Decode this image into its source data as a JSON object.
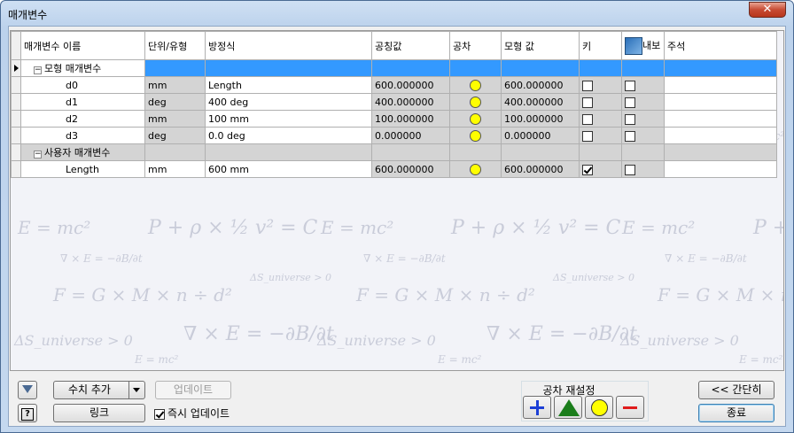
{
  "window": {
    "title": "매개변수",
    "close_glyph": "✕"
  },
  "table": {
    "headers": [
      "매개변수 이름",
      "단위/유형",
      "방정식",
      "공칭값",
      "공차",
      "모형 값",
      "키",
      "내보",
      "주석"
    ],
    "groups": [
      {
        "label": "모형 매개변수",
        "expander": "−",
        "rows": [
          {
            "name": "d0",
            "unit": "mm",
            "equation": "Length",
            "nominal": "600.000000",
            "model": "600.000000",
            "key": false,
            "export": false
          },
          {
            "name": "d1",
            "unit": "deg",
            "equation": "400 deg",
            "nominal": "400.000000",
            "model": "400.000000",
            "key": false,
            "export": false
          },
          {
            "name": "d2",
            "unit": "mm",
            "equation": "100 mm",
            "nominal": "100.000000",
            "model": "100.000000",
            "key": false,
            "export": false
          },
          {
            "name": "d3",
            "unit": "deg",
            "equation": "0.0 deg",
            "nominal": "0.000000",
            "model": "0.000000",
            "key": false,
            "export": false
          }
        ]
      },
      {
        "label": "사용자 매개변수",
        "expander": "−",
        "rows": [
          {
            "name": "Length",
            "unit": "mm",
            "equation": "600 mm",
            "nominal": "600.000000",
            "model": "600.000000",
            "key": true,
            "export": false
          }
        ]
      }
    ],
    "tolerance_color": "#ffff00",
    "selection_color": "#3399ff"
  },
  "background_formulas": {
    "emc2": "E = mc²",
    "bernoulli": "P + ρ × ½ v² = C",
    "curl": "∇ × E = −∂B/∂t",
    "gravity": "F = G × M × n ÷ d²",
    "entropy": "ΔS_universe > 0"
  },
  "toolbar": {
    "filter_icon": "filter-icon",
    "help_icon": "help-icon",
    "add_numeric_label": "수치 추가",
    "update_label": "업데이트",
    "link_label": "링크",
    "immediate_update_label": "즉시 업데이트",
    "immediate_update_checked": true,
    "tolerance_group_label": "공차 재설정",
    "less_label": "<< 간단히",
    "done_label": "종료"
  }
}
